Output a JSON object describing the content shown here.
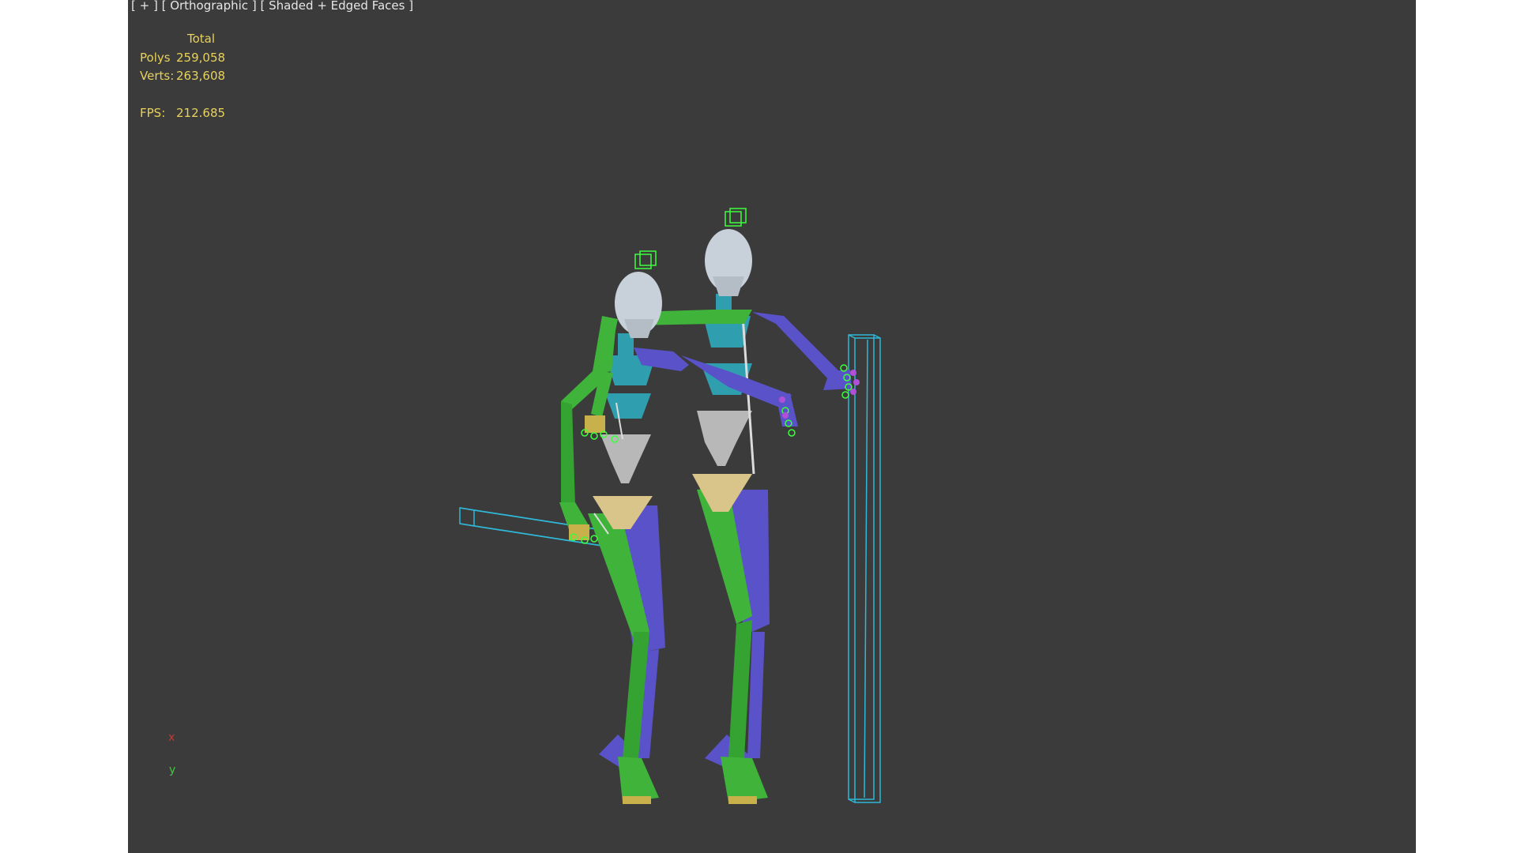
{
  "viewport": {
    "label": "[ + ] [ Orthographic ] [ Shaded + Edged Faces ]",
    "background": "#3b3b3b"
  },
  "stats": {
    "header": "Total",
    "polys_label": "Polys",
    "polys_value": "259,058",
    "verts_label": "Verts:",
    "verts_value": "263,608",
    "fps_label": "FPS:",
    "fps_value": "212.685",
    "color": "#e8d25a"
  },
  "axis_gizmo": {
    "x_label": "x",
    "y_label": "y",
    "x_color": "#c43a3a",
    "y_color": "#3ecb3e"
  },
  "scene": {
    "objects": [
      "biped-figure-left",
      "biped-figure-right",
      "box-helper-horizontal",
      "box-helper-vertical"
    ],
    "colors": {
      "green_bone": "#3fb33a",
      "blue_bone": "#5a52c9",
      "teal_spine": "#2f9fb0",
      "grey_pelvis": "#b8b8b8",
      "tan_hip": "#d9c48a",
      "head": "#c8d0da",
      "wire": "#2fb8d8",
      "selection": "#3cff3c"
    }
  }
}
